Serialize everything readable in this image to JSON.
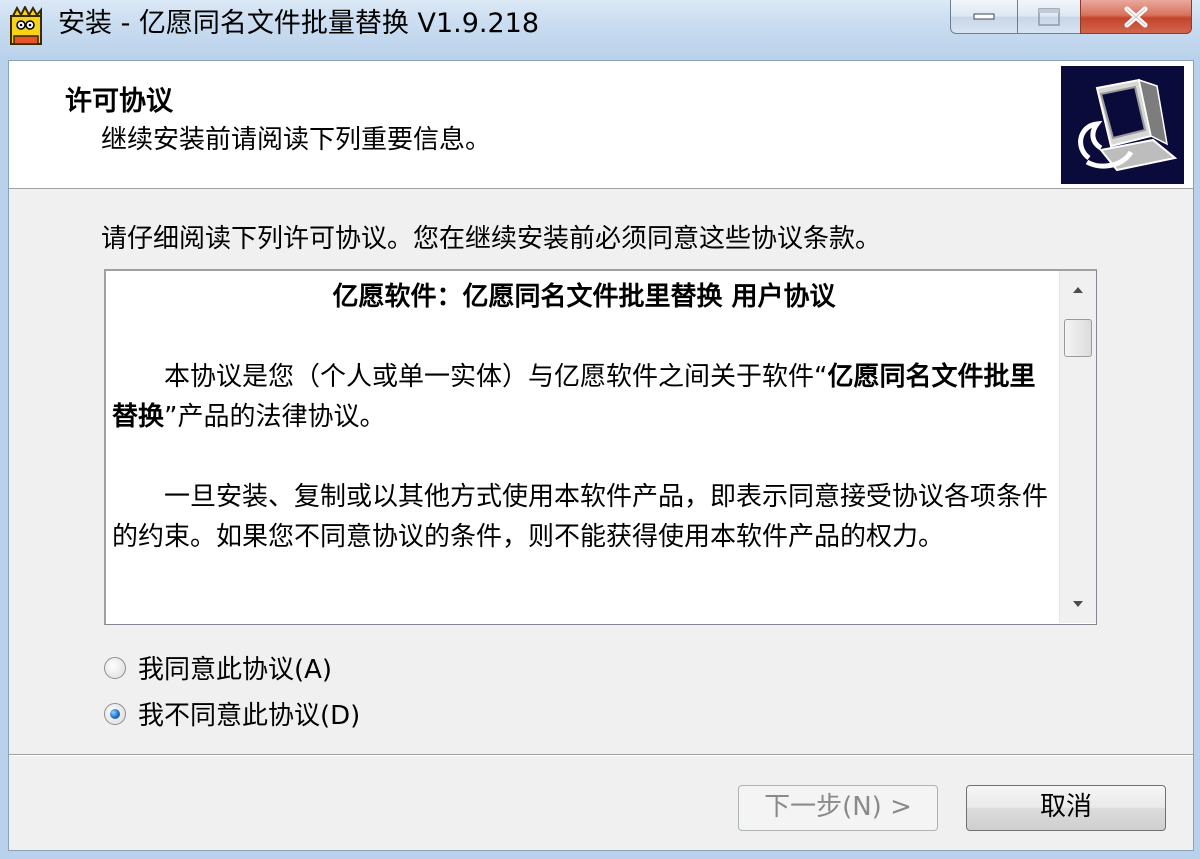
{
  "window": {
    "title": "安装 - 亿愿同名文件批量替换 V1.9.218",
    "accent": "#b9d1ea"
  },
  "header": {
    "title": "许可协议",
    "subtitle": "继续安装前请阅读下列重要信息。"
  },
  "main": {
    "instruction": "请仔细阅读下列许可协议。您在继续安装前必须同意这些协议条款。",
    "license": {
      "heading": "亿愿软件：亿愿同名文件批里替换  用户协议",
      "p1_pre": "本协议是您（个人或单一实体）与亿愿软件之间关于软件“",
      "p1_bold": "亿愿同名文件批里替换",
      "p1_post": "”产品的法律协议。",
      "p2": "一旦安装、复制或以其他方式使用本软件产品，即表示同意接受协议各项条件的约束。如果您不同意协议的条件，则不能获得使用本软件产品的权力。"
    },
    "options": [
      {
        "label": "我同意此协议(A)",
        "checked": false
      },
      {
        "label": "我不同意此协议(D)",
        "checked": true
      }
    ]
  },
  "footer": {
    "next_label": "下一步(N) >",
    "cancel_label": "取消"
  }
}
